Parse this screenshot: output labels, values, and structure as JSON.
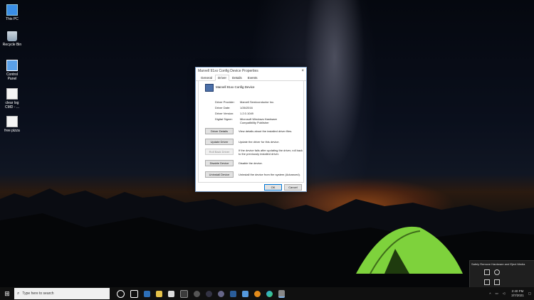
{
  "desktop": {
    "icons": [
      {
        "label": "This PC"
      },
      {
        "label": "Recycle Bin"
      },
      {
        "label": "Control Panel"
      },
      {
        "label": "clear log CMD - ..."
      },
      {
        "label": "free pizza"
      }
    ]
  },
  "dialog": {
    "title": "Marvell 91xx Config Device Properties",
    "close_icon": "×",
    "tabs": [
      "General",
      "Driver",
      "Details",
      "Events"
    ],
    "active_tab": "Driver",
    "device_name": "Marvell 91xx Config Device",
    "info": [
      {
        "key": "Driver Provider:",
        "value": "Marvell Semiconductor Inc."
      },
      {
        "key": "Driver Date:",
        "value": "1/26/2016"
      },
      {
        "key": "Driver Version:",
        "value": "1.2.0.1049"
      },
      {
        "key": "Digital Signer:",
        "value": "Microsoft Windows Hardware Compatibility Publisher"
      }
    ],
    "actions": [
      {
        "label": "Driver Details",
        "desc": "View details about the installed driver files.",
        "disabled": false
      },
      {
        "label": "Update Driver",
        "desc": "Update the driver for this device.",
        "disabled": false
      },
      {
        "label": "Roll Back Driver",
        "desc": "If the device fails after updating the driver, roll back to the previously installed driver.",
        "disabled": true
      },
      {
        "label": "Disable Device",
        "desc": "Disable the device.",
        "disabled": false
      },
      {
        "label": "Uninstall Device",
        "desc": "Uninstall the device from the system (Advanced).",
        "disabled": false
      }
    ],
    "ok_label": "OK",
    "cancel_label": "Cancel"
  },
  "tray_popup": {
    "tooltip": "Safely Remove Hardware and Eject Media"
  },
  "taskbar": {
    "search_placeholder": "Type here to search",
    "time": "2:40 PM",
    "date": "3/7/2021"
  }
}
